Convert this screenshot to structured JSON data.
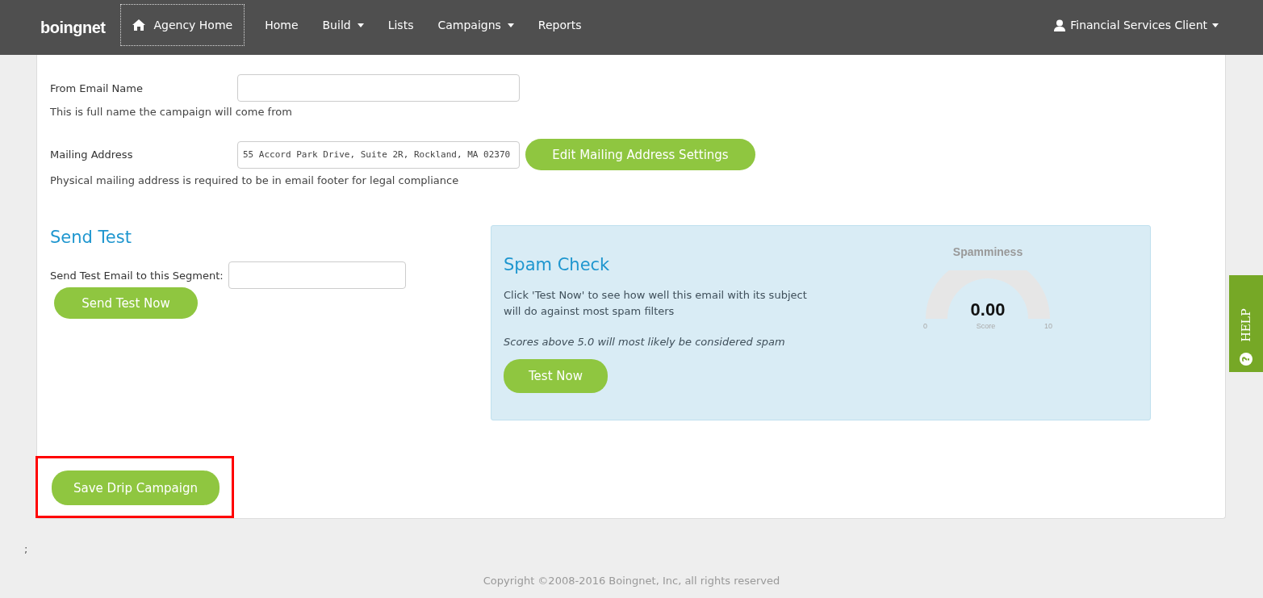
{
  "navbar": {
    "logo": "boingnet",
    "items": [
      {
        "label": "Agency Home",
        "kind": "home",
        "selected": true
      },
      {
        "label": "Home",
        "kind": "link",
        "selected": false
      },
      {
        "label": "Build",
        "kind": "dropdown",
        "selected": false
      },
      {
        "label": "Lists",
        "kind": "link",
        "selected": false
      },
      {
        "label": "Campaigns",
        "kind": "dropdown",
        "selected": false
      },
      {
        "label": "Reports",
        "kind": "link",
        "selected": false
      }
    ],
    "user": "Financial Services Client"
  },
  "form": {
    "fields": [
      {
        "label": "From Email Name",
        "help": "This is full name the campaign will come from"
      },
      {
        "label": "Mailing Address",
        "value": "55 Accord Park Drive, Suite 2R, Rockland, MA 02370",
        "button": "Edit Mailing Address Settings",
        "help": "Physical mailing address is required to be in email footer for legal compliance"
      }
    ]
  },
  "send_test": {
    "title": "Send Test",
    "label": "Send Test Email to this Segment:",
    "button": "Send Test Now"
  },
  "spam_check": {
    "title": "Spam Check",
    "description": "Click 'Test Now' to see how well this email with its subject will do against most spam filters",
    "note": "Scores above 5.0 will most likely be considered spam",
    "button": "Test Now",
    "gauge": {
      "title": "Spamminess",
      "value": "0.00",
      "caption": "Score",
      "min": "0",
      "max": "10"
    }
  },
  "save": {
    "label": "Save Drip Campaign",
    "highlighted": true
  },
  "stray_text": ";",
  "footer": "Copyright ©2008-2016 Boingnet, Inc, all rights reserved",
  "help_tab": {
    "label": "HELP",
    "icon": "?"
  }
}
